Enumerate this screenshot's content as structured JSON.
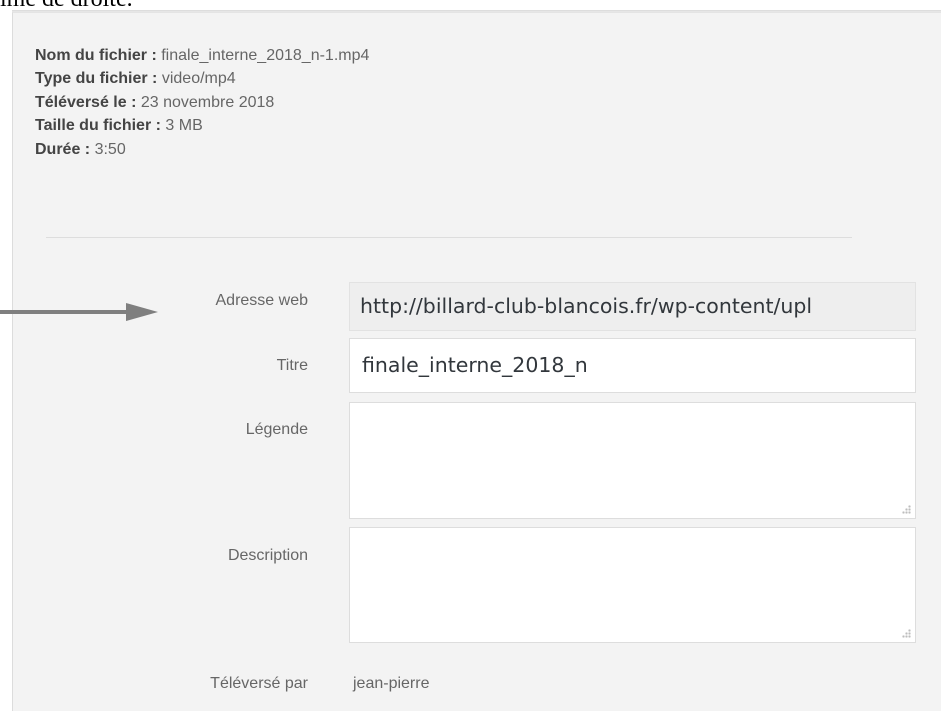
{
  "document_fragment": "ime de droite.",
  "file_details": {
    "filename_label": "Nom du fichier :",
    "filename_value": "finale_interne_2018_n-1.mp4",
    "filetype_label": "Type du fichier :",
    "filetype_value": "video/mp4",
    "uploaded_on_label": "Téléversé le :",
    "uploaded_on_value": "23 novembre 2018",
    "filesize_label": "Taille du fichier :",
    "filesize_value": "3 MB",
    "duration_label": "Durée :",
    "duration_value": "3:50"
  },
  "fields": {
    "url_label": "Adresse web",
    "url_value": "http://billard-club-blancois.fr/wp-content/upl",
    "title_label": "Titre",
    "title_value": "finale_interne_2018_n",
    "caption_label": "Légende",
    "caption_value": "",
    "description_label": "Description",
    "description_value": "",
    "uploaded_by_label": "Téléversé par",
    "uploaded_by_value": "jean-pierre"
  },
  "icons": {
    "annotation_arrow": "right-arrow-icon",
    "resize_handle": "resize-grip-icon"
  },
  "colors": {
    "panel_background": "#f3f3f3",
    "text_muted": "#666666",
    "arrow": "#7f7f7f"
  }
}
